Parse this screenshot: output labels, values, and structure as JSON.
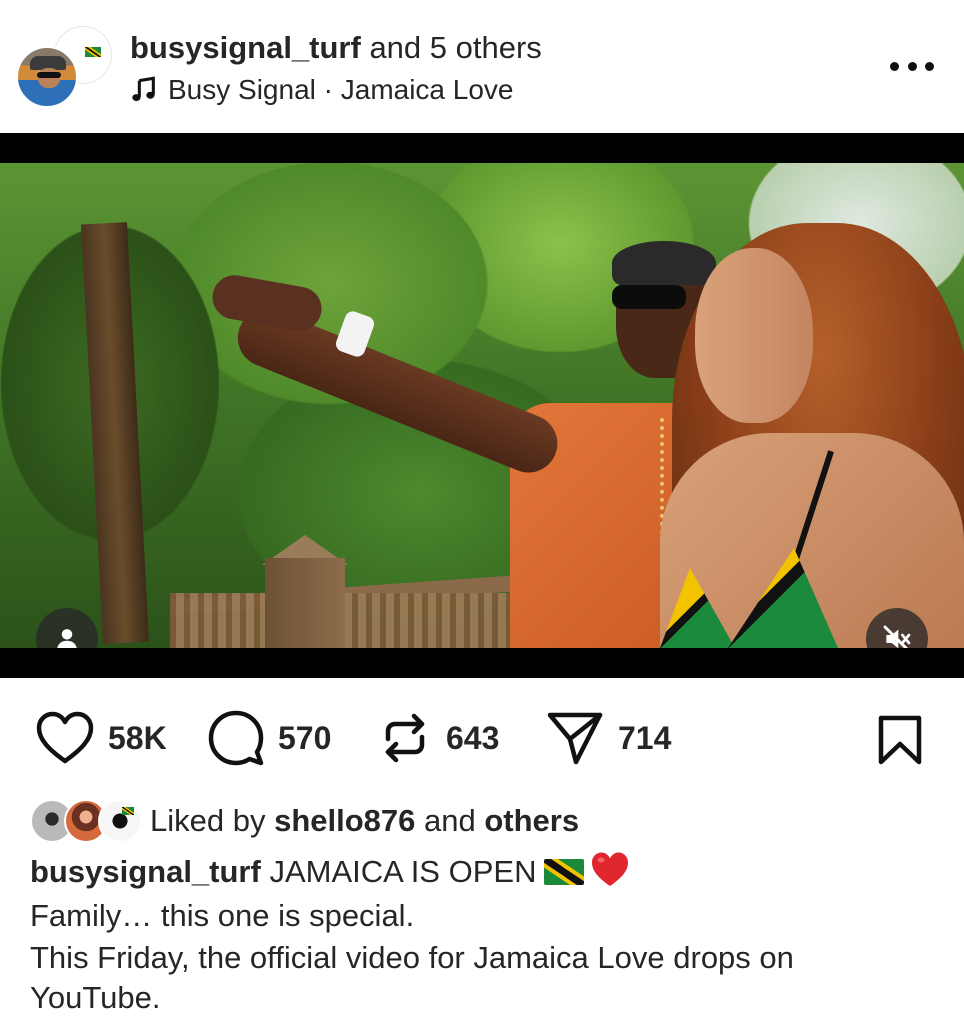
{
  "header": {
    "username": "busysignal_turf",
    "collaborators_suffix": " and 5 others",
    "music_track": "Busy Signal · Jamaica Love"
  },
  "actions": {
    "likes": "58K",
    "comments": "570",
    "reposts": "643",
    "shares": "714"
  },
  "liked_by": {
    "prefix": "Liked by ",
    "user": "shello876",
    "mid": " and ",
    "others": "others"
  },
  "caption": {
    "username": "busysignal_turf",
    "line1": " JAMAICA IS OPEN",
    "line2": "Family… this one is special.",
    "line3": "This Friday, the official video for Jamaica Love drops on YouTube."
  },
  "icons": {
    "music": "music-note-icon",
    "more": "more-options-icon",
    "like": "heart-icon",
    "comment": "comment-icon",
    "repost": "repost-icon",
    "share": "share-icon",
    "save": "bookmark-icon",
    "tags": "person-icon",
    "mute": "muted-speaker-icon"
  },
  "colors": {
    "text": "#262626",
    "background": "#ffffff",
    "heart_emoji": "#e0262f",
    "flag_green": "#1a8a3a",
    "flag_gold": "#f2c200"
  }
}
